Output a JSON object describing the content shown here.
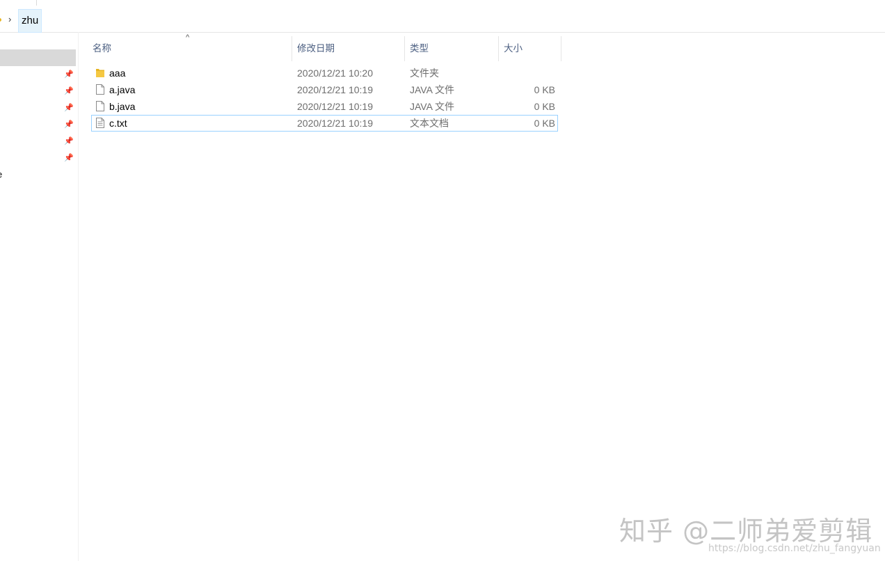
{
  "address": {
    "crumb": "zhu",
    "chevron_icon": "chevron-right"
  },
  "columns": {
    "name": "名称",
    "date": "修改日期",
    "type": "类型",
    "size": "大小",
    "sort_icon": "caret-up"
  },
  "files": [
    {
      "icon": "folder-icon",
      "name": "aaa",
      "date": "2020/12/21 10:20",
      "type": "文件夹",
      "size": ""
    },
    {
      "icon": "file-icon",
      "name": "a.java",
      "date": "2020/12/21 10:19",
      "type": "JAVA 文件",
      "size": "0 KB"
    },
    {
      "icon": "file-icon",
      "name": "b.java",
      "date": "2020/12/21 10:19",
      "type": "JAVA 文件",
      "size": "0 KB"
    },
    {
      "icon": "text-file-icon",
      "name": "c.txt",
      "date": "2020/12/21 10:19",
      "type": "文本文档",
      "size": "0 KB"
    }
  ],
  "nav": {
    "pin_icon": "pin-icon",
    "partial_label": "e"
  },
  "watermark": {
    "zhihu": "知乎 @二师弟爱剪辑",
    "csdn": "https://blog.csdn.net/zhu_fangyuan"
  },
  "colors": {
    "header_text": "#4d6082",
    "crumb_bg": "#e5f3fb",
    "focus_border": "#99d1ff",
    "folder": "#e6b422"
  }
}
